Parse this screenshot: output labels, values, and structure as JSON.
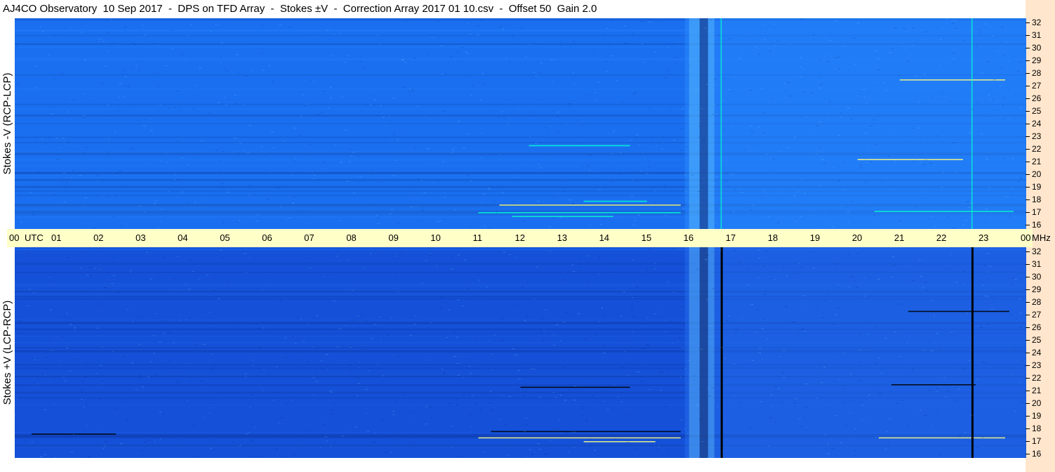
{
  "title": "AJ4CO Observatory  10 Sep 2017  -  DPS on TFD Array  -  Stokes ±V  -  Correction Array 2017 01 10.csv  -  Offset 50  Gain 2.0",
  "chart_data": [
    {
      "type": "heatmap",
      "ylabel": "Stokes -V (RCP-LCP)",
      "x_unit": "UTC",
      "y_unit": "MHz",
      "xlim": [
        0,
        24
      ],
      "ylim": [
        16,
        32
      ],
      "colors": {
        "base": "#1a6ff0",
        "enhanced": "#2b8cff",
        "bright": "#6fd3ff",
        "line": "#00ffd0",
        "dark": "#0a2a80"
      },
      "vertical_lines_utc": [
        16.75,
        22.7
      ]
    },
    {
      "type": "heatmap",
      "ylabel": "Stokes +V (LCP-RCP)",
      "x_unit": "UTC",
      "y_unit": "MHz",
      "xlim": [
        0,
        24
      ],
      "ylim": [
        16,
        32
      ],
      "colors": {
        "base": "#1450d8",
        "enhanced": "#2572f0",
        "bright": "#6fd3ff",
        "line": "#000000",
        "dark": "#082070"
      },
      "vertical_lines_utc": [
        16.75,
        22.7
      ]
    }
  ],
  "time_axis": {
    "labels": [
      "00",
      "01",
      "02",
      "03",
      "04",
      "05",
      "06",
      "07",
      "08",
      "09",
      "10",
      "11",
      "12",
      "13",
      "14",
      "15",
      "16",
      "17",
      "18",
      "19",
      "20",
      "21",
      "22",
      "23",
      "00"
    ],
    "utc_label": "UTC",
    "mhz_label": "MHz"
  },
  "freq_axis": {
    "labels": [
      "32",
      "31",
      "30",
      "29",
      "28",
      "27",
      "26",
      "25",
      "24",
      "23",
      "22",
      "21",
      "20",
      "19",
      "18",
      "17",
      "16"
    ]
  }
}
